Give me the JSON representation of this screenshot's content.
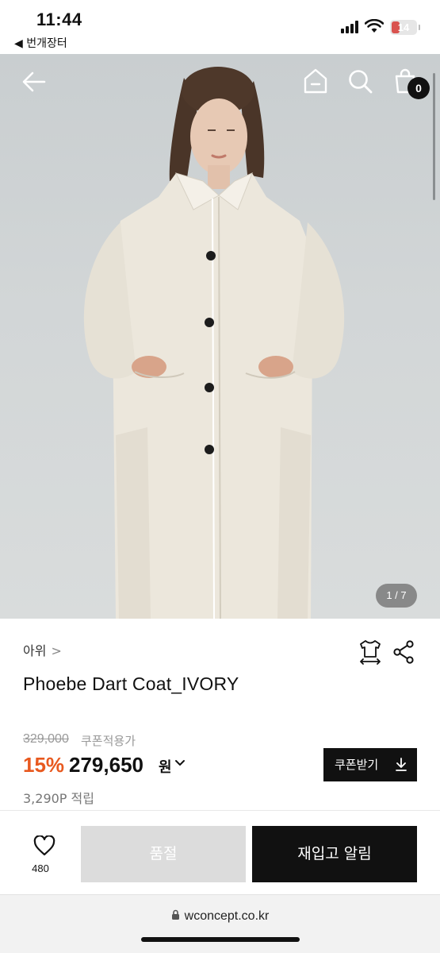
{
  "status_bar": {
    "time": "11:44",
    "back_app": "◀ 번개장터",
    "battery": "14",
    "battery_color": "#d9534f"
  },
  "nav": {
    "back_icon": "arrow-left-icon",
    "home_icon": "home-icon",
    "search_icon": "search-icon",
    "cart_icon": "shopping-bag-icon",
    "cart_count": "0"
  },
  "gallery": {
    "pager": "1 / 7"
  },
  "product": {
    "brand": "아위",
    "brand_chevron": ">",
    "name": "Phoebe Dart Coat_IVORY",
    "size_icon": "size-guide-icon",
    "share_icon": "share-icon"
  },
  "price": {
    "original": "329,000",
    "coupon_note": "쿠폰적용가",
    "discount": "15%",
    "sale": "279,650",
    "currency": "원",
    "discount_color": "#e8591f",
    "coupon_button": "쿠폰받기",
    "points": "3,290P 적립"
  },
  "actions": {
    "like_icon": "heart-icon",
    "like_count": "480",
    "soldout": "품절",
    "restock": "재입고 알림"
  },
  "browser": {
    "url": "wconcept.co.kr"
  }
}
